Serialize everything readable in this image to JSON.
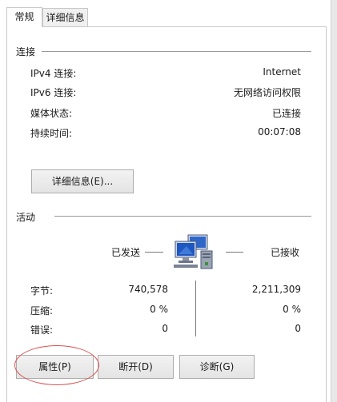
{
  "tabs": [
    {
      "label": "常规",
      "active": true
    },
    {
      "label": "详细信息",
      "active": false
    }
  ],
  "connection": {
    "title": "连接",
    "rows": [
      {
        "label": "IPv4 连接:",
        "value": "Internet"
      },
      {
        "label": "IPv6 连接:",
        "value": "无网络访问权限"
      },
      {
        "label": "媒体状态:",
        "value": "已连接"
      },
      {
        "label": "持续时间:",
        "value": "00:07:08"
      }
    ],
    "details_button": "详细信息(E)..."
  },
  "activity": {
    "title": "活动",
    "sent_label": "已发送",
    "received_label": "已接收",
    "rows": [
      {
        "label": "字节:",
        "sent": "740,578",
        "received": "2,211,309"
      },
      {
        "label": "压缩:",
        "sent": "0 %",
        "received": "0 %"
      },
      {
        "label": "错误:",
        "sent": "0",
        "received": "0"
      }
    ]
  },
  "buttons": {
    "properties": "属性(P)",
    "disconnect": "断开(D)",
    "diagnose": "诊断(G)"
  },
  "icons": {
    "network_activity": "network-computers-icon"
  },
  "colors": {
    "highlight_ring": "#d9534f",
    "panel_border": "#c8c8c8"
  }
}
